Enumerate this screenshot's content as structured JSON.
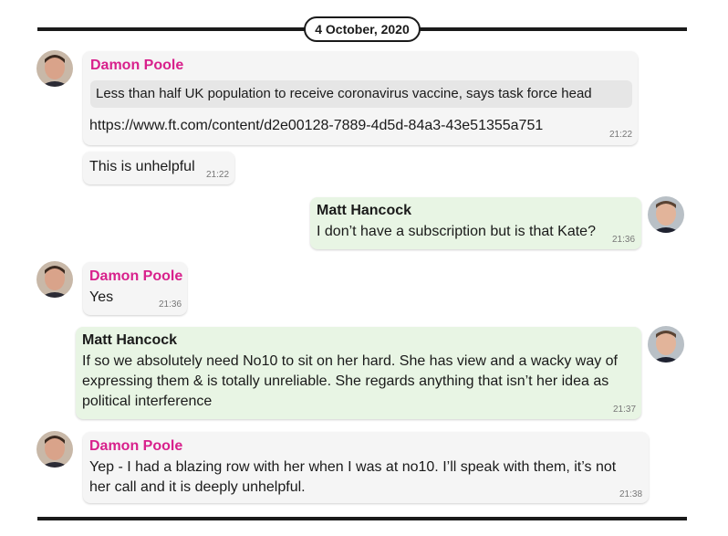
{
  "date_separator": "4 October, 2020",
  "messages": [
    {
      "sender": "Damon Poole",
      "quote": "Less than half UK population to receive coronavirus vaccine, says task force head",
      "link": "https://www.ft.com/content/d2e00128-7889-4d5d-84a3-43e51355a751",
      "time": "21:22"
    },
    {
      "text": "This is unhelpful",
      "time": "21:22"
    },
    {
      "sender": "Matt Hancock",
      "text": "I don’t have a subscription but is that Kate?",
      "time": "21:36"
    },
    {
      "sender": "Damon Poole",
      "text": "Yes",
      "time": "21:36"
    },
    {
      "sender": "Matt Hancock",
      "text_lines": [
        "If so we absolutely need No10 to sit on her hard. She has view and a wacky way of",
        "expressing them & is totally unreliable. She regards anything that isn’t her idea as",
        "political interference"
      ],
      "time": "21:37"
    },
    {
      "sender": "Damon Poole",
      "text_lines": [
        "Yep - I had a blazing row with her when I was at no10. I’ll speak with them, it’s not",
        "her call and it is deeply unhelpful."
      ],
      "time": "21:38"
    }
  ],
  "colors": {
    "incoming_bubble": "#f5f5f5",
    "outgoing_bubble": "#e8f5e4",
    "damon_name": "#d8218c",
    "rule": "#1a1a1a"
  },
  "icons": {
    "damon_avatar": "avatar-photo",
    "matt_avatar": "avatar-photo"
  }
}
